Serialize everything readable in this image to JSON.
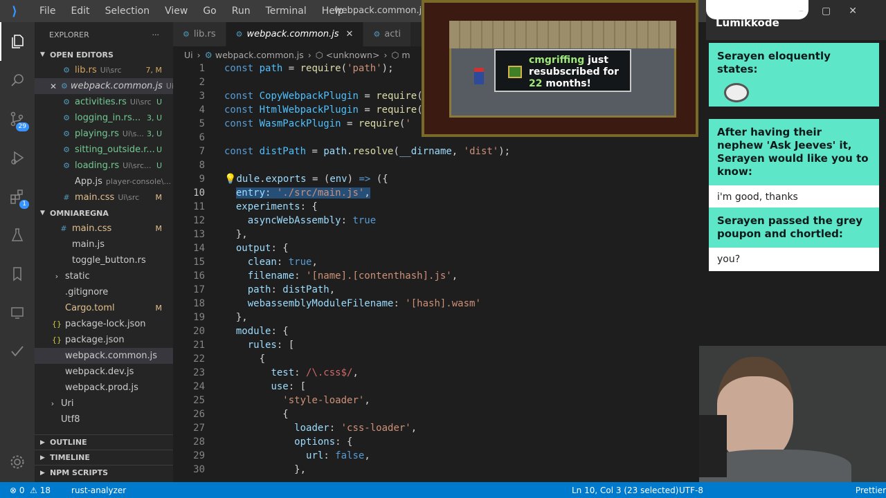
{
  "titlebar": {
    "menus": [
      "File",
      "Edit",
      "Selection",
      "View",
      "Go",
      "Run",
      "Terminal",
      "Help"
    ],
    "window_title": "webpack.common.js"
  },
  "activity": {
    "scm_badge": "29",
    "ext_badge": "1"
  },
  "explorer": {
    "header": "EXPLORER",
    "open_editors_label": "OPEN EDITORS",
    "open_editors": [
      {
        "name": "lib.rs",
        "dir": "Ui\\src",
        "status": "7, M",
        "icon": "rust-icon",
        "color": "o"
      },
      {
        "name": "webpack.common.js",
        "dir": "Ui",
        "status": "",
        "icon": "gear-icon",
        "color": "",
        "italic": true
      },
      {
        "name": "activities.rs",
        "dir": "Ui\\src",
        "status": "U",
        "icon": "rust-icon",
        "color": "g"
      },
      {
        "name": "logging_in.rs...",
        "dir": "",
        "status": "3, U",
        "icon": "rust-icon",
        "color": "g"
      },
      {
        "name": "playing.rs",
        "dir": "Ui\\s...",
        "status": "3, U",
        "icon": "rust-icon",
        "color": "g"
      },
      {
        "name": "sitting_outside.r...",
        "dir": "",
        "status": "U",
        "icon": "rust-icon",
        "color": "g"
      },
      {
        "name": "loading.rs",
        "dir": "Ui\\src...",
        "status": "U",
        "icon": "rust-icon",
        "color": "g"
      },
      {
        "name": "App.js",
        "dir": "player-console\\...",
        "status": "",
        "icon": "js-icon",
        "color": ""
      },
      {
        "name": "main.css",
        "dir": "Ui\\src",
        "status": "M",
        "icon": "css-icon",
        "color": "y"
      }
    ],
    "project_label": "OMNIAREGNA",
    "files": [
      {
        "name": "main.css",
        "status": "M",
        "icon": "#",
        "color": "y",
        "indent": 2
      },
      {
        "name": "main.js",
        "status": "",
        "icon": "",
        "color": "",
        "indent": 2
      },
      {
        "name": "toggle_button.rs",
        "status": "",
        "icon": "",
        "color": "",
        "indent": 2
      },
      {
        "name": "static",
        "status": "",
        "icon": "›",
        "color": "",
        "indent": 1
      },
      {
        "name": ".gitignore",
        "status": "",
        "icon": "",
        "color": "",
        "indent": 1
      },
      {
        "name": "Cargo.toml",
        "status": "M",
        "icon": "",
        "color": "y",
        "indent": 1
      },
      {
        "name": "package-lock.json",
        "status": "",
        "icon": "{}",
        "color": "",
        "indent": 1
      },
      {
        "name": "package.json",
        "status": "",
        "icon": "{}",
        "color": "",
        "indent": 1
      },
      {
        "name": "webpack.common.js",
        "status": "",
        "icon": "",
        "color": "",
        "indent": 1,
        "sel": true
      },
      {
        "name": "webpack.dev.js",
        "status": "",
        "icon": "",
        "color": "",
        "indent": 1
      },
      {
        "name": "webpack.prod.js",
        "status": "",
        "icon": "",
        "color": "",
        "indent": 1
      },
      {
        "name": "Uri",
        "status": "",
        "icon": "›",
        "color": "",
        "indent": 0
      },
      {
        "name": "Utf8",
        "status": "",
        "icon": "",
        "color": "",
        "indent": 0
      }
    ],
    "outline_label": "OUTLINE",
    "timeline_label": "TIMELINE",
    "npm_label": "NPM SCRIPTS"
  },
  "tabs": [
    {
      "label": "lib.rs",
      "active": false
    },
    {
      "label": "webpack.common.js",
      "active": true
    },
    {
      "label": "acti",
      "active": false
    }
  ],
  "breadcrumb": [
    "Ui",
    "webpack.common.js",
    "<unknown>",
    "m"
  ],
  "code": {
    "line_numbers": [
      "1",
      "2",
      "3",
      "4",
      "5",
      "6",
      "7",
      "8",
      "9",
      "10",
      "11",
      "12",
      "13",
      "14",
      "15",
      "16",
      "17",
      "18",
      "19",
      "20",
      "21",
      "22",
      "23",
      "24",
      "25",
      "26",
      "27",
      "28",
      "29",
      "30"
    ],
    "current_line": 10
  },
  "overlay": {
    "user": "cmgriffing",
    "message": "just resubscribed for",
    "months": "22",
    "months_label": "months!"
  },
  "chat": {
    "channel": "Lumikkode",
    "messages": [
      {
        "header": "Serayen eloquently states:",
        "body": ""
      },
      {
        "header": "After having their nephew 'Ask Jeeves' it, Serayen would like you to know:",
        "body": "i'm good, thanks"
      },
      {
        "header": "Serayen passed the grey poupon and chortled:",
        "body": "you?"
      }
    ]
  },
  "status": {
    "errors": "0",
    "warnings": "18",
    "analyzer": "rust-analyzer",
    "cursor": "Ln 10, Col 3 (23 selected)",
    "encoding": "UTF-8",
    "formatter": "Prettier"
  },
  "colors": {
    "status_bar": "#007acc",
    "chat_card": "#5ee6c8",
    "selection": "#264f78"
  }
}
